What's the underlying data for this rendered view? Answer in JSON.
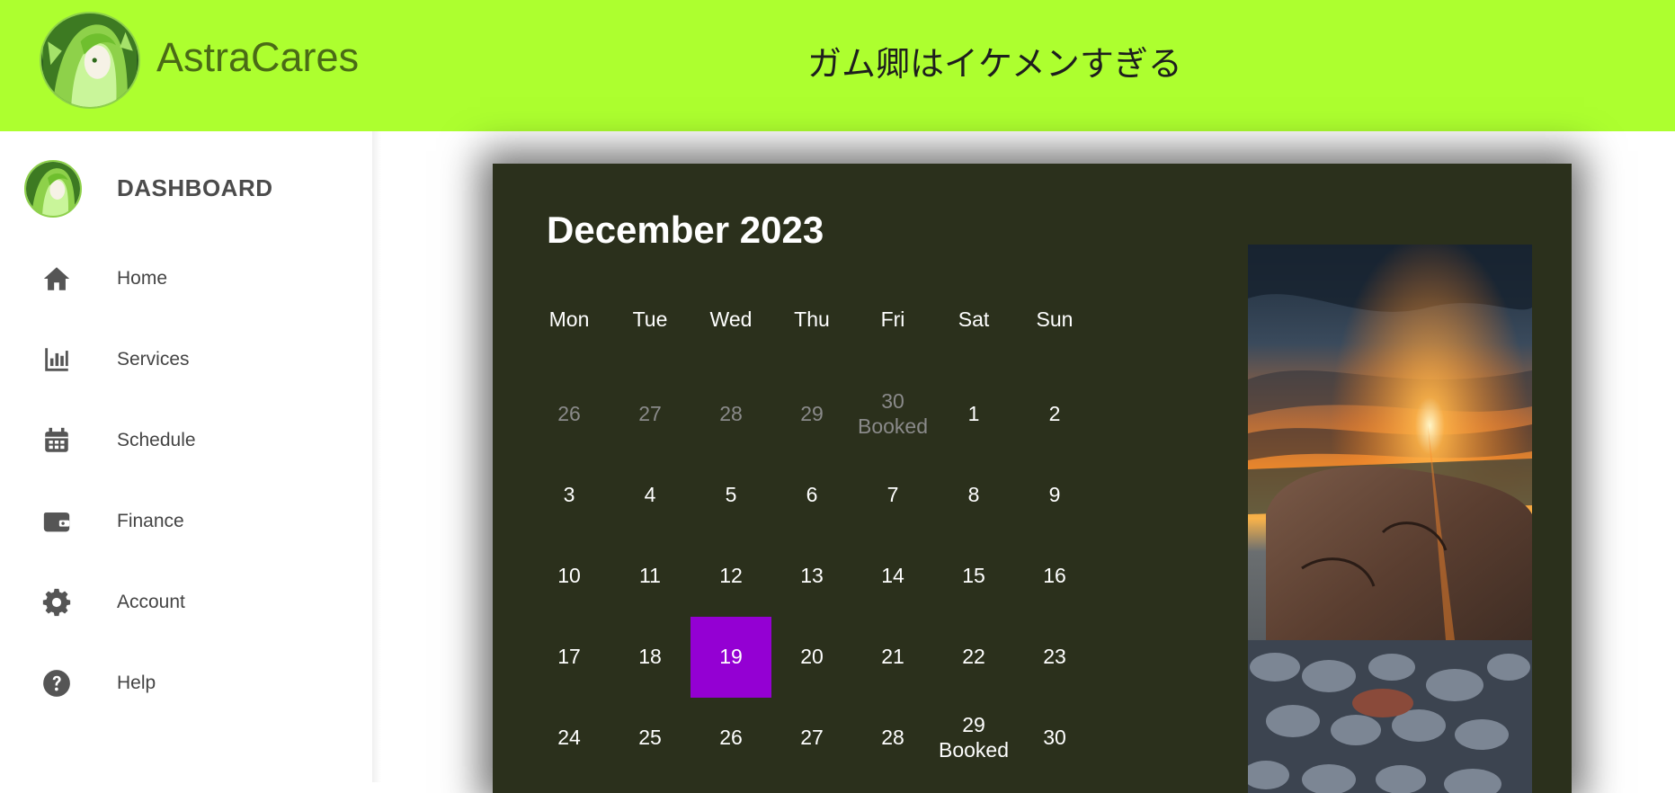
{
  "header": {
    "brand": "AstraCares",
    "message": "ガム卿はイケメンすぎる"
  },
  "sidebar": {
    "title": "DASHBOARD",
    "items": [
      {
        "label": "Home",
        "icon": "home-icon"
      },
      {
        "label": "Services",
        "icon": "bar-chart-icon"
      },
      {
        "label": "Schedule",
        "icon": "calendar-icon"
      },
      {
        "label": "Finance",
        "icon": "wallet-icon"
      },
      {
        "label": "Account",
        "icon": "gear-icon"
      },
      {
        "label": "Help",
        "icon": "question-circle-icon"
      }
    ]
  },
  "calendar": {
    "title": "December 2023",
    "weekdays": [
      "Mon",
      "Tue",
      "Wed",
      "Thu",
      "Fri",
      "Sat",
      "Sun"
    ],
    "weeks": [
      [
        {
          "day": "26",
          "muted": true
        },
        {
          "day": "27",
          "muted": true
        },
        {
          "day": "28",
          "muted": true
        },
        {
          "day": "29",
          "muted": true
        },
        {
          "day": "30",
          "note": "Booked",
          "muted": true
        },
        {
          "day": "1"
        },
        {
          "day": "2"
        }
      ],
      [
        {
          "day": "3"
        },
        {
          "day": "4"
        },
        {
          "day": "5"
        },
        {
          "day": "6"
        },
        {
          "day": "7"
        },
        {
          "day": "8"
        },
        {
          "day": "9"
        }
      ],
      [
        {
          "day": "10"
        },
        {
          "day": "11"
        },
        {
          "day": "12"
        },
        {
          "day": "13"
        },
        {
          "day": "14"
        },
        {
          "day": "15"
        },
        {
          "day": "16"
        }
      ],
      [
        {
          "day": "17"
        },
        {
          "day": "18"
        },
        {
          "day": "19",
          "today": true
        },
        {
          "day": "20"
        },
        {
          "day": "21"
        },
        {
          "day": "22"
        },
        {
          "day": "23"
        }
      ],
      [
        {
          "day": "24"
        },
        {
          "day": "25"
        },
        {
          "day": "26"
        },
        {
          "day": "27"
        },
        {
          "day": "28"
        },
        {
          "day": "29",
          "note": "Booked"
        },
        {
          "day": "30"
        }
      ]
    ]
  },
  "colors": {
    "header_bg": "#adff2f",
    "card_bg": "#2b301c",
    "today": "#9400d3",
    "brand_text": "#4a6b16"
  }
}
